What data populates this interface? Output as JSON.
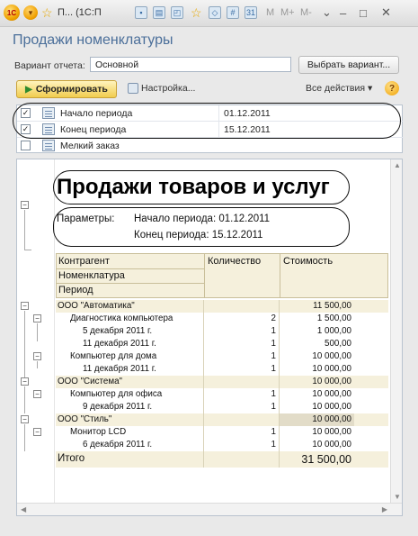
{
  "titlebar": {
    "title": "П... (1С:П",
    "m_labels": [
      "M",
      "M+",
      "M-"
    ]
  },
  "header": {
    "heading": "Продажи номенклатуры",
    "variant_label": "Вариант отчета:",
    "variant_value": "Основной",
    "choose_variant": "Выбрать вариант...",
    "generate": "Сформировать",
    "settings": "Настройка...",
    "all_actions": "Все действия ▾"
  },
  "params": [
    {
      "checked": true,
      "name": "Начало периода",
      "value": "01.12.2011"
    },
    {
      "checked": true,
      "name": "Конец периода",
      "value": "15.12.2011"
    },
    {
      "checked": false,
      "name": "Мелкий заказ",
      "value": ""
    }
  ],
  "report": {
    "title": "Продажи товаров и услуг",
    "params_label": "Параметры:",
    "param_start": "Начало периода: 01.12.2011",
    "param_end": "Конец периода: 15.12.2011",
    "headers": {
      "col1": [
        "Контрагент",
        "Номенклатура",
        "Период"
      ],
      "col2": "Количество",
      "col3": "Стоимость"
    },
    "rows": [
      {
        "name": "ООО \"Автоматика\"",
        "qty": "",
        "cost": "11 500,00",
        "level": 0
      },
      {
        "name": "Диагностика компьютера",
        "qty": "2",
        "cost": "1 500,00",
        "level": 1
      },
      {
        "name": "5 декабря 2011 г.",
        "qty": "1",
        "cost": "1 000,00",
        "level": 2
      },
      {
        "name": "11 декабря 2011 г.",
        "qty": "1",
        "cost": "500,00",
        "level": 2
      },
      {
        "name": "Компьютер для дома",
        "qty": "1",
        "cost": "10 000,00",
        "level": 1
      },
      {
        "name": "11 декабря 2011 г.",
        "qty": "1",
        "cost": "10 000,00",
        "level": 2
      },
      {
        "name": "ООО \"Система\"",
        "qty": "",
        "cost": "10 000,00",
        "level": 0
      },
      {
        "name": "Компьютер для офиса",
        "qty": "1",
        "cost": "10 000,00",
        "level": 1
      },
      {
        "name": "9 декабря 2011 г.",
        "qty": "1",
        "cost": "10 000,00",
        "level": 2
      },
      {
        "name": "ООО \"Стиль\"",
        "qty": "",
        "cost": "10 000,00",
        "level": 0
      },
      {
        "name": "Монитор LCD",
        "qty": "1",
        "cost": "10 000,00",
        "level": 1
      },
      {
        "name": "6 декабря 2011 г.",
        "qty": "1",
        "cost": "10 000,00",
        "level": 2
      }
    ],
    "total": {
      "name": "Итого",
      "cost": "31 500,00"
    }
  }
}
